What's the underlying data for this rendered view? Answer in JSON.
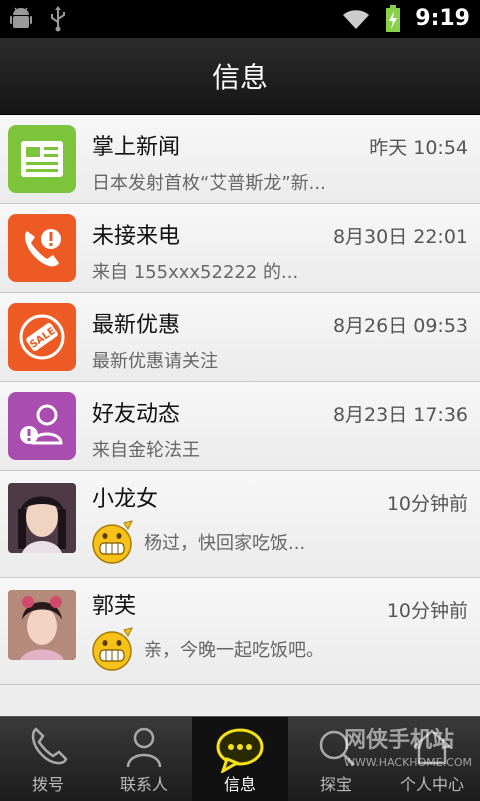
{
  "status_bar": {
    "time": "9:19",
    "icons": [
      "android-icon",
      "usb-icon",
      "wifi-icon",
      "battery-charging-icon"
    ]
  },
  "header": {
    "title": "信息"
  },
  "messages": [
    {
      "name": "掌上新闻",
      "time": "昨天 10:54",
      "preview": "日本发射首枚“艾普斯龙”新...",
      "icon": "news-icon",
      "color": "#7cc43a"
    },
    {
      "name": "未接来电",
      "time": "8月30日 22:01",
      "preview": "来自 155xxx52222 的...",
      "icon": "missed-call-icon",
      "color": "#ee5a24"
    },
    {
      "name": "最新优惠",
      "time": "8月26日 09:53",
      "preview": "最新优惠请关注",
      "icon": "sale-tag-icon",
      "color": "#ee5a24"
    },
    {
      "name": "好友动态",
      "time": "8月23日 17:36",
      "preview": "来自金轮法王",
      "icon": "friend-alert-icon",
      "color": "#a94db0"
    },
    {
      "name": "小龙女",
      "time": "10分钟前",
      "preview": "杨过，快回家吃饭...",
      "icon": "avatar",
      "emoji": "grin-emoji-icon"
    },
    {
      "name": "郭芙",
      "time": "10分钟前",
      "preview": "亲，今晚一起吃饭吧。",
      "icon": "avatar",
      "emoji": "grin-emoji-icon"
    }
  ],
  "tabs": [
    {
      "label": "拨号",
      "icon": "phone-icon"
    },
    {
      "label": "联系人",
      "icon": "person-icon"
    },
    {
      "label": "信息",
      "icon": "chat-bubble-icon",
      "active": true
    },
    {
      "label": "探宝",
      "icon": "search-icon"
    },
    {
      "label": "个人中心",
      "icon": "home-icon"
    }
  ],
  "watermark": {
    "text": "网侠手机站",
    "url": "WWW.HACKHOME.COM"
  }
}
